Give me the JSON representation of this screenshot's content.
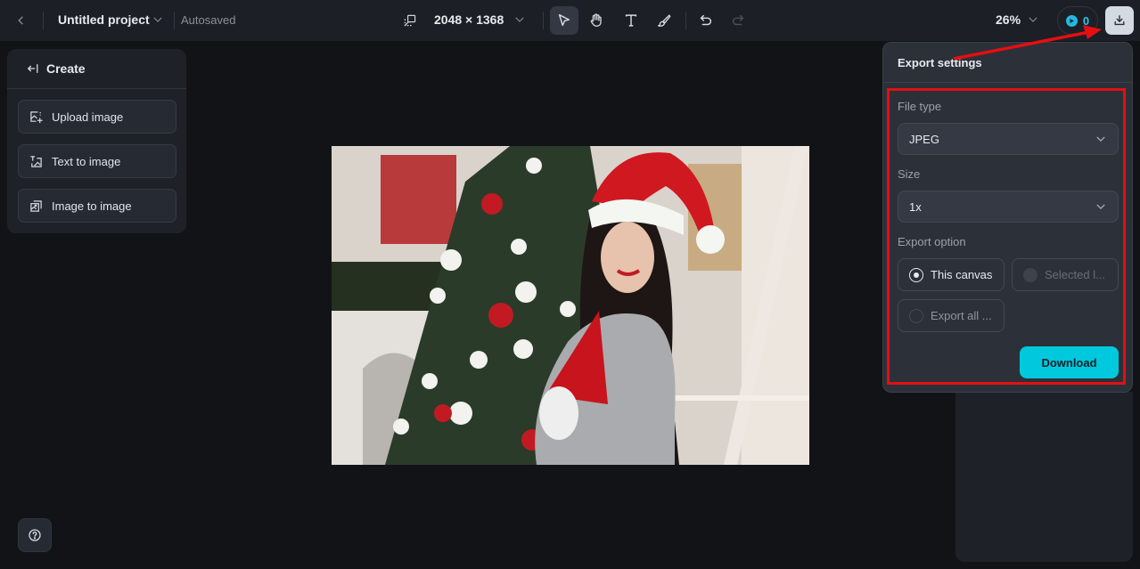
{
  "topbar": {
    "project_title": "Untitled project",
    "save_status": "Autosaved",
    "canvas_size": "2048 × 1368",
    "zoom": "26%",
    "credits": "0"
  },
  "tools": [
    {
      "name": "select",
      "active": true
    },
    {
      "name": "hand",
      "active": false
    },
    {
      "name": "text",
      "active": false
    },
    {
      "name": "brush",
      "active": false
    }
  ],
  "create_panel": {
    "title": "Create",
    "items": [
      {
        "label": "Upload image",
        "icon": "upload-image-icon"
      },
      {
        "label": "Text to image",
        "icon": "text-to-image-icon"
      },
      {
        "label": "Image to image",
        "icon": "image-to-image-icon"
      }
    ]
  },
  "canvas": {
    "image_description": "Woman in grey sweater wearing a Santa hat, holding a gnome, in front of a decorated Christmas tree"
  },
  "export_settings": {
    "title": "Export settings",
    "file_type_label": "File type",
    "file_type_value": "JPEG",
    "size_label": "Size",
    "size_value": "1x",
    "export_option_label": "Export option",
    "options": [
      {
        "label": "This canvas",
        "state": "selected"
      },
      {
        "label": "Selected l...",
        "state": "disabled"
      },
      {
        "label": "Export all ...",
        "state": "unselected"
      }
    ],
    "download_label": "Download"
  },
  "colors": {
    "accent": "#00c8dd",
    "annotation": "#e30f12",
    "credit": "#2cc6e8"
  }
}
